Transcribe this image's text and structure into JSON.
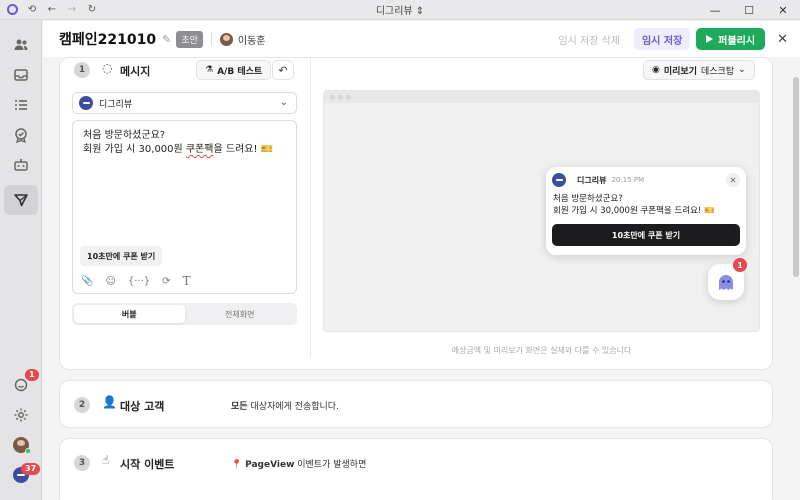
{
  "window": {
    "title": "디그리뷰 ⇕"
  },
  "sidebar": {
    "items": [
      {
        "icon": "users-icon"
      },
      {
        "icon": "inbox-icon"
      },
      {
        "icon": "list-icon"
      },
      {
        "icon": "badge-icon"
      },
      {
        "icon": "bot-icon"
      },
      {
        "icon": "send-icon"
      }
    ],
    "notify_badge": "1",
    "workspace_badge": "37"
  },
  "header": {
    "title": "캠페인221010",
    "status": "초안",
    "owner": "이동훈",
    "delete_draft": "임시 저장 삭제",
    "save_draft": "임시 저장",
    "publish": "퍼블리시"
  },
  "step1": {
    "number": "1",
    "title": "메시지",
    "ab_test": "A/B 테스트",
    "sender": "디그리뷰",
    "editor_line1": "처음 방문하셨군요?",
    "editor_line2_a": "회원 가입 시 30,000원 ",
    "editor_line2_b": "쿠폰팩",
    "editor_line2_c": "을 드려요! 🎫",
    "cta_label": "10초만에 쿠폰 받기",
    "seg_bubble": "버블",
    "seg_full": "전체화면",
    "preview_label": "미리보기",
    "preview_device": "데스크탑",
    "disclaimer": "예상금액 및 미리보기 화면은 실제와 다를 수 있습니다"
  },
  "popup": {
    "sender": "디그리뷰",
    "time": "20:15 PM",
    "line1": "처음 방문하셨군요?",
    "line2": "회원 가입 시 30,000원 쿠폰팩을 드려요! 🎫",
    "cta": "10초만에 쿠폰 받기",
    "launcher_badge": "1"
  },
  "step2": {
    "number": "2",
    "title": "대상 고객",
    "desc_bold": "모든",
    "desc_rest": " 대상자에게 전송합니다."
  },
  "step3": {
    "number": "3",
    "title": "시작 이벤트",
    "desc_bold": "PageView",
    "desc_rest": " 이벤트가 발생하면"
  }
}
